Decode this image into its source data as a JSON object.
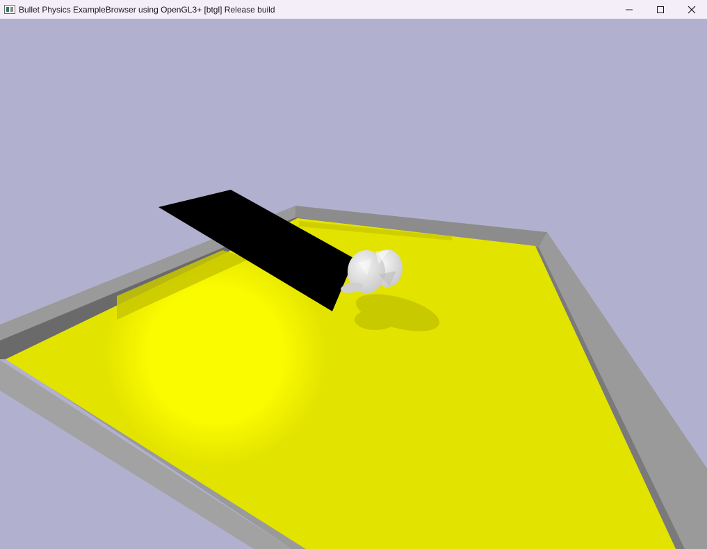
{
  "window": {
    "title": "Bullet Physics ExampleBrowser using OpenGL3+ [btgl] Release build",
    "controls": {
      "minimize": "minimize",
      "maximize": "maximize",
      "close": "close"
    }
  },
  "scene": {
    "background_color": "#b1b1cf",
    "floor_color": "#e3e300",
    "floor_highlight_color": "#ffff00",
    "wall_color": "#9a9a9a",
    "inner_wall_color": "#6e6e6e",
    "paddle_color": "#000000",
    "object_color": "#e8e8e8"
  }
}
